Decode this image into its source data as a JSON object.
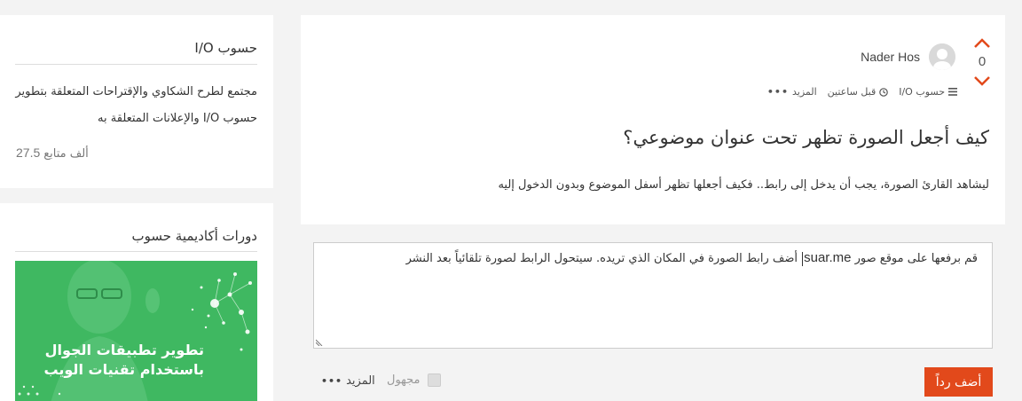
{
  "post": {
    "vote_count": "0",
    "author": "Nader Hos",
    "meta": {
      "category": "حسوب I/O",
      "time": "قبل ساعتين",
      "more": "المزيد"
    },
    "title": "كيف أجعل الصورة تظهر تحت عنوان موضوعي؟",
    "body": "ليشاهد القارئ الصورة، يجب أن يدخل إلى رابط.. فكيف أجعلها تظهر أسفل الموضوع وبدون الدخول إليه"
  },
  "reply": {
    "text_before": "قم برفعها على موقع صور",
    "site": "suar.me",
    "text_after": "أضف رابط الصورة في المكان الذي تريده. سيتحول الرابط لصورة تلقائياً بعد النشر",
    "submit_label": "أضف رداً",
    "anonymous_label": "مجهول",
    "more_label": "المزيد"
  },
  "sidebar": {
    "community_title": "حسوب I/O",
    "community_desc": "مجتمع لطرح الشكاوي والإقتراحات المتعلقة بتطوير حسوب I/O والإعلانات المتعلقة به",
    "followers_count": "27.5",
    "followers_label": "ألف متابع",
    "courses_title": "دورات أكاديمية حسوب",
    "promo_line1": "تطوير تطبيقات الجوال",
    "promo_line2": "باستخدام تقنيات الويب"
  },
  "colors": {
    "accent": "#e2491b",
    "promo_green": "#3fb861"
  },
  "icons": {
    "upvote": "chevron-up-icon",
    "downvote": "chevron-down-icon",
    "category": "list-icon",
    "time": "clock-icon",
    "more": "ellipsis-icon"
  }
}
